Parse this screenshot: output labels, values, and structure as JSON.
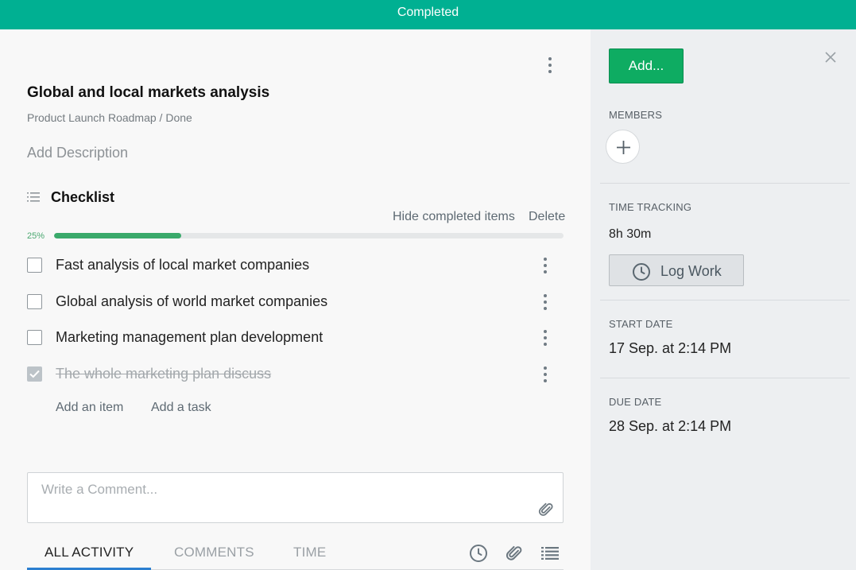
{
  "banner": {
    "status": "Completed"
  },
  "task": {
    "title": "Global and local markets analysis",
    "breadcrumb": "Product Launch Roadmap / Done",
    "add_description": "Add Description"
  },
  "checklist": {
    "title": "Checklist",
    "hide_completed": "Hide completed items",
    "delete": "Delete",
    "progress_label": "25%",
    "progress": 0.25,
    "items": [
      {
        "text": "Fast analysis of local market companies",
        "checked": false
      },
      {
        "text": "Global analysis of world market companies",
        "checked": false
      },
      {
        "text": "Marketing management plan development",
        "checked": false
      },
      {
        "text": "The whole marketing plan discuss",
        "checked": true
      }
    ],
    "add_item": "Add an item",
    "add_task": "Add a task"
  },
  "comment": {
    "placeholder": "Write a Comment..."
  },
  "tabs": [
    {
      "label": "ALL ACTIVITY",
      "active": true
    },
    {
      "label": "COMMENTS",
      "active": false
    },
    {
      "label": "TIME",
      "active": false
    }
  ],
  "sidebar": {
    "add_button": "Add...",
    "members_label": "MEMBERS",
    "time_tracking_label": "TIME TRACKING",
    "time_tracked": "8h 30m",
    "log_work": "Log Work",
    "start_date_label": "START DATE",
    "start_date": "17 Sep. at 2:14 PM",
    "due_date_label": "DUE DATE",
    "due_date": "28 Sep. at 2:14 PM"
  },
  "colors": {
    "banner": "#00b092",
    "add_button": "#0eac62",
    "progress": "#3aaa6b",
    "tab_underline": "#2c7fd0"
  },
  "icons": [
    "kebab-menu-icon",
    "checklist-icon",
    "checkmark-icon",
    "paperclip-icon",
    "clock-icon",
    "list-icon",
    "close-icon",
    "plus-icon"
  ]
}
